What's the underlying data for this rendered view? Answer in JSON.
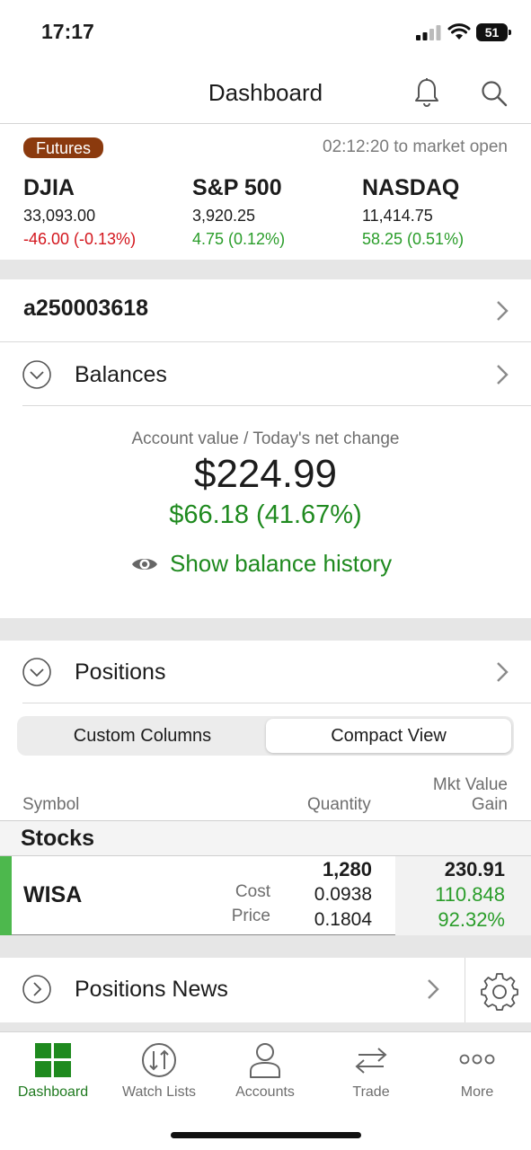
{
  "status": {
    "time": "17:17",
    "battery": "51"
  },
  "header": {
    "title": "Dashboard"
  },
  "futures": {
    "badge": "Futures",
    "market_open": "02:12:20 to market open",
    "indices": [
      {
        "name": "DJIA",
        "value": "33,093.00",
        "change": "-46.00 (-0.13%)",
        "direction": "down"
      },
      {
        "name": "S&P 500",
        "value": "3,920.25",
        "change": "4.75 (0.12%)",
        "direction": "up"
      },
      {
        "name": "NASDAQ",
        "value": "11,414.75",
        "change": "58.25 (0.51%)",
        "direction": "up"
      }
    ]
  },
  "account": {
    "id": "a250003618"
  },
  "balances": {
    "title": "Balances",
    "caption": "Account value / Today's net change",
    "value": "$224.99",
    "change": "$66.18 (41.67%)",
    "history_label": "Show balance history"
  },
  "positions": {
    "title": "Positions",
    "segments": [
      "Custom Columns",
      "Compact View"
    ],
    "active_segment": "Compact View",
    "columns": {
      "symbol": "Symbol",
      "quantity": "Quantity",
      "mkt_value": "Mkt Value",
      "gain": "Gain"
    },
    "group": "Stocks",
    "rows": [
      {
        "symbol": "WISA",
        "quantity": "1,280",
        "cost_label": "Cost",
        "cost": "0.0938",
        "price_label": "Price",
        "price": "0.1804",
        "mkt_value": "230.91",
        "gain": "110.848",
        "gain_pct": "92.32%"
      }
    ]
  },
  "news": {
    "title": "Positions News"
  },
  "tabs": [
    {
      "label": "Dashboard",
      "icon": "dashboard-icon",
      "active": true
    },
    {
      "label": "Watch Lists",
      "icon": "watch-lists-icon",
      "active": false
    },
    {
      "label": "Accounts",
      "icon": "accounts-icon",
      "active": false
    },
    {
      "label": "Trade",
      "icon": "trade-icon",
      "active": false
    },
    {
      "label": "More",
      "icon": "more-icon",
      "active": false
    }
  ],
  "colors": {
    "accent": "#1f8a1f",
    "negative": "#d3161d",
    "futures_badge": "#8b3a0e",
    "position_bar": "#4db84d"
  }
}
